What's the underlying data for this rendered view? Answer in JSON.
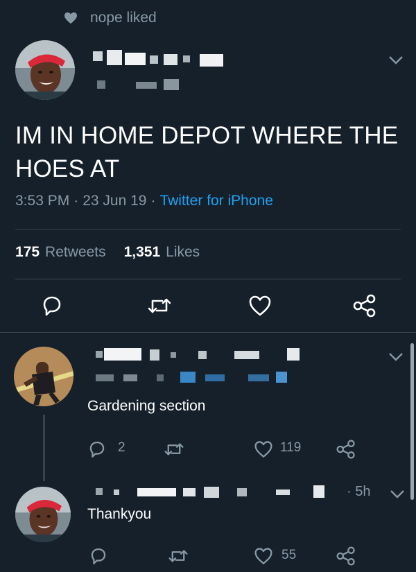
{
  "social_context": {
    "icon": "heart-icon",
    "text": "nope liked"
  },
  "main_tweet": {
    "text": "IM IN HOME DEPOT WHERE THE HOES AT",
    "time": "3:53 PM",
    "separator": "·",
    "date": "23 Jun 19",
    "source": "Twitter for iPhone",
    "retweets_count": "175",
    "retweets_label": "Retweets",
    "likes_count": "1,351",
    "likes_label": "Likes",
    "actions": [
      "reply-icon",
      "retweet-icon",
      "like-icon",
      "share-icon"
    ]
  },
  "replies": [
    {
      "text": "Gardening section",
      "reply_count": "2",
      "retweet_count": "",
      "like_count": "119"
    },
    {
      "text": "Thankyou",
      "timestamp": "· 5h",
      "reply_count": "",
      "retweet_count": "",
      "like_count": "55"
    }
  ],
  "colors": {
    "background": "#15202b",
    "muted": "#8899a6",
    "accent": "#1da1f2",
    "divider": "#38444d"
  }
}
